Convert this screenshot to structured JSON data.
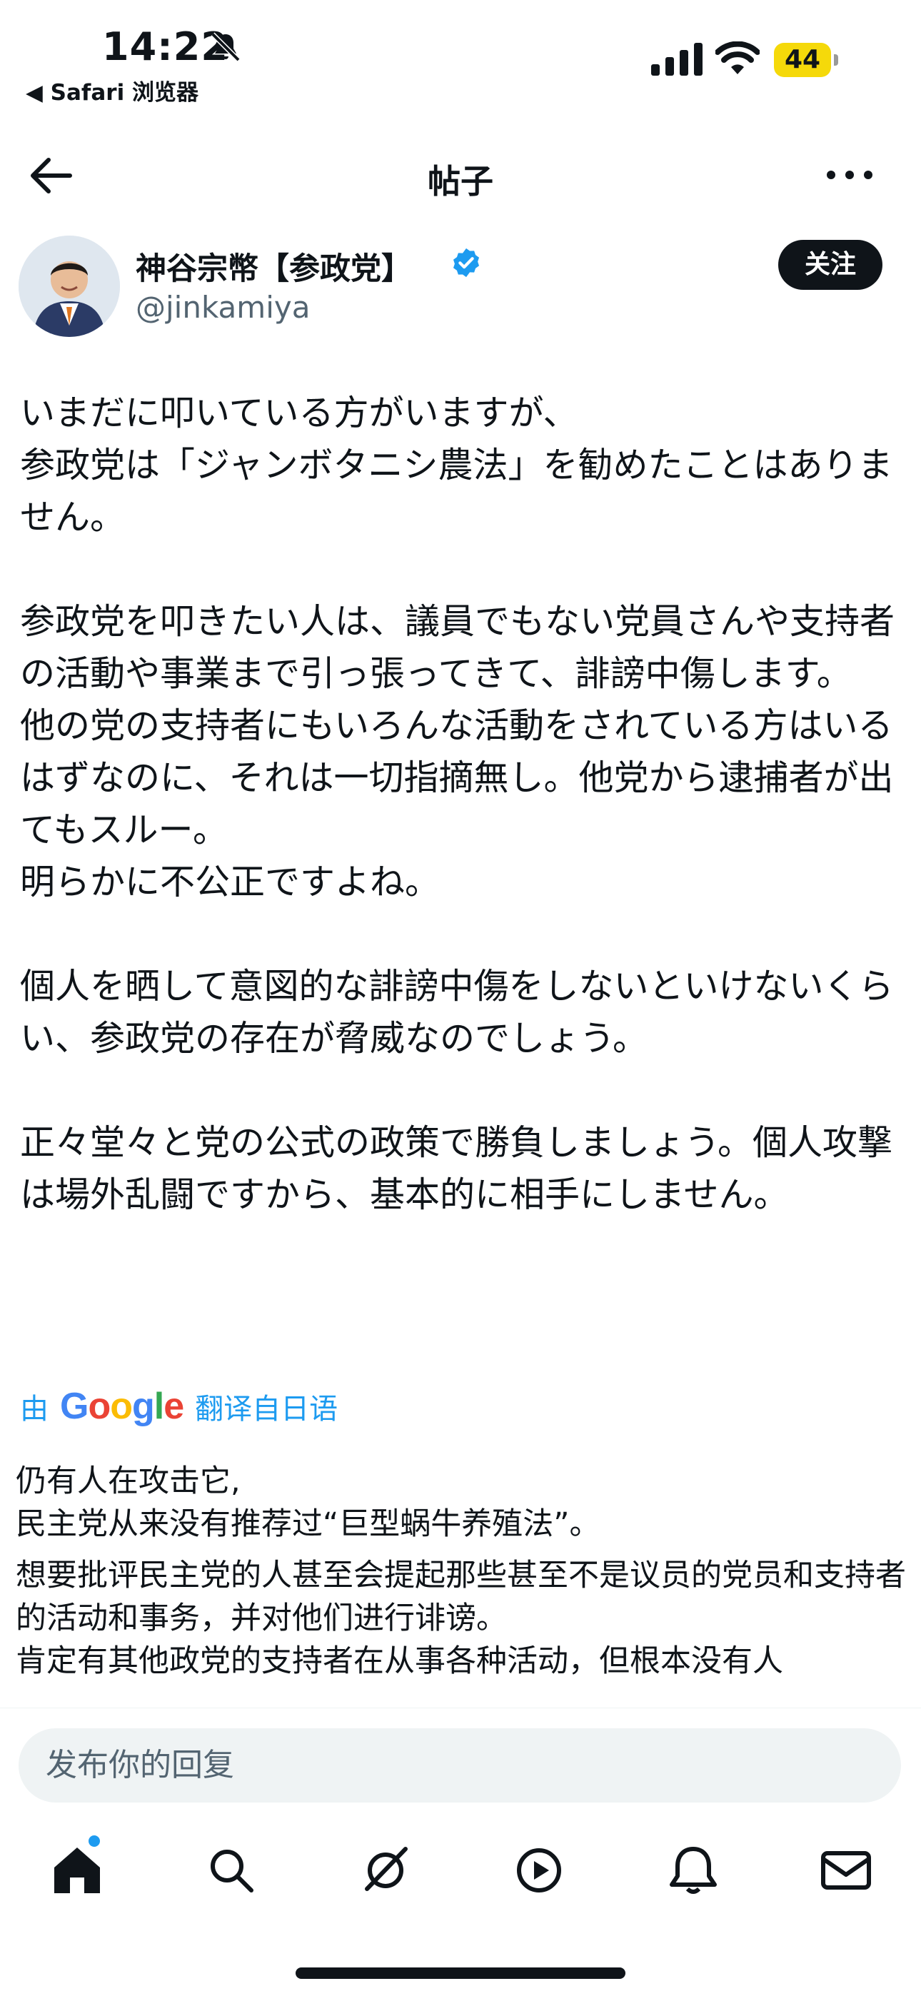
{
  "status_bar": {
    "time": "14:22",
    "back_app": "◀ Safari 浏览器",
    "battery": "44"
  },
  "header": {
    "title": "帖子"
  },
  "author": {
    "display_name": "神谷宗幣【参政党】",
    "handle": "@jinkamiya",
    "follow_label": "关注"
  },
  "tweet": {
    "paragraphs": [
      "いまだに叩いている方がいますが、\n参政党は「ジャンボタニシ農法」を勧めたことはありません。",
      "参政党を叩きたい人は、議員でもない党員さんや支持者の活動や事業まで引っ張ってきて、誹謗中傷します。\n他の党の支持者にもいろんな活動をされている方はいるはずなのに、それは一切指摘無し。他党から逮捕者が出てもスルー。\n明らかに不公正ですよね。",
      "個人を晒して意図的な誹謗中傷をしないといけないくらい、参政党の存在が脅威なのでしょう。",
      "正々堂々と党の公式の政策で勝負しましょう。個人攻撃は場外乱闘ですから、基本的に相手にしません。"
    ]
  },
  "translation": {
    "prefix": "由",
    "brand": "Google",
    "suffix": "翻译自日语",
    "paragraphs": [
      "仍有人在攻击它,\n民主党从来没有推荐过“巨型蜗牛养殖法”。",
      "想要批评民主党的人甚至会提起那些甚至不是议员的党员和支持者的活动和事务，并对他们进行诽谤。\n肯定有其他政党的支持者在从事各种活动，但根本没有人"
    ]
  },
  "reply": {
    "placeholder": "发布你的回复"
  },
  "tabs": [
    "home-icon",
    "search-icon",
    "grok-icon",
    "video-icon",
    "notifications-icon",
    "messages-icon"
  ],
  "colors": {
    "accent": "#1d9bf0",
    "text": "#0f1419",
    "muted": "#536471",
    "battery": "#f5d90a"
  }
}
